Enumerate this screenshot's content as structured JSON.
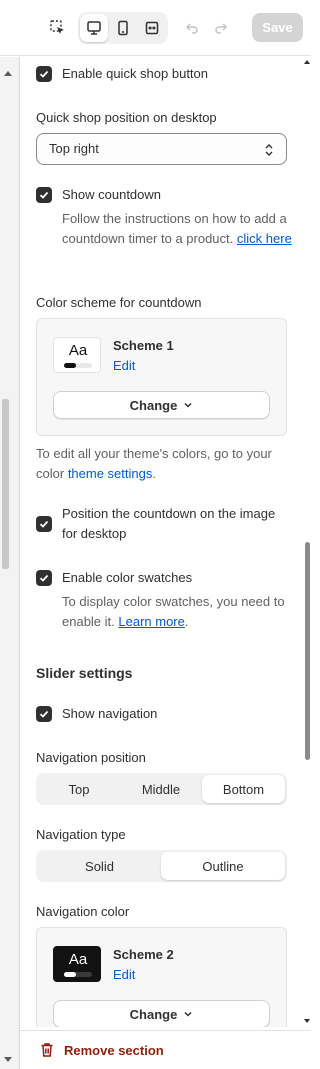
{
  "toolbar": {
    "select_icon": "cursor-select-icon",
    "desktop_icon": "desktop-icon",
    "mobile_icon": "mobile-icon",
    "fullwidth_icon": "fullscreen-icon",
    "undo_icon": "undo-icon",
    "redo_icon": "redo-icon",
    "save_label": "Save"
  },
  "quick_shop": {
    "enable_label": "Enable quick shop button",
    "enabled": true,
    "position_label": "Quick shop position on desktop",
    "position_value": "Top right"
  },
  "countdown": {
    "show_label": "Show countdown",
    "enabled": true,
    "help_text": "Follow the instructions on how to add a countdown timer to a product.",
    "help_link": "click here",
    "scheme_label": "Color scheme for countdown",
    "scheme_name": "Scheme 1",
    "scheme_edit": "Edit",
    "swatch_text": "Aa",
    "change_label": "Change",
    "theme_note_prefix": "To edit all your theme's colors, go to your color",
    "theme_note_link": "theme settings",
    "theme_note_suffix": ".",
    "position_image_label": "Position the countdown on the image for desktop",
    "position_image_enabled": true
  },
  "swatches": {
    "enable_label": "Enable color swatches",
    "enabled": true,
    "help_text": "To display color swatches, you need to enable it.",
    "help_link": "Learn more",
    "help_suffix": "."
  },
  "slider": {
    "heading": "Slider settings",
    "show_nav_label": "Show navigation",
    "show_nav_enabled": true,
    "nav_position_label": "Navigation position",
    "nav_positions": [
      "Top",
      "Middle",
      "Bottom"
    ],
    "nav_position_selected": "Bottom",
    "nav_type_label": "Navigation type",
    "nav_types": [
      "Solid",
      "Outline"
    ],
    "nav_type_selected": "Outline",
    "nav_color_label": "Navigation color",
    "nav_scheme_name": "Scheme 2",
    "nav_scheme_edit": "Edit",
    "nav_swatch_text": "Aa",
    "nav_change_label": "Change"
  },
  "footer": {
    "remove_label": "Remove section",
    "remove_icon": "trash-icon"
  },
  "colors": {
    "accent_link": "#005bd3",
    "checkbox": "#303030",
    "danger": "#8e1f0b",
    "save_disabled": "#d4d4d4"
  }
}
